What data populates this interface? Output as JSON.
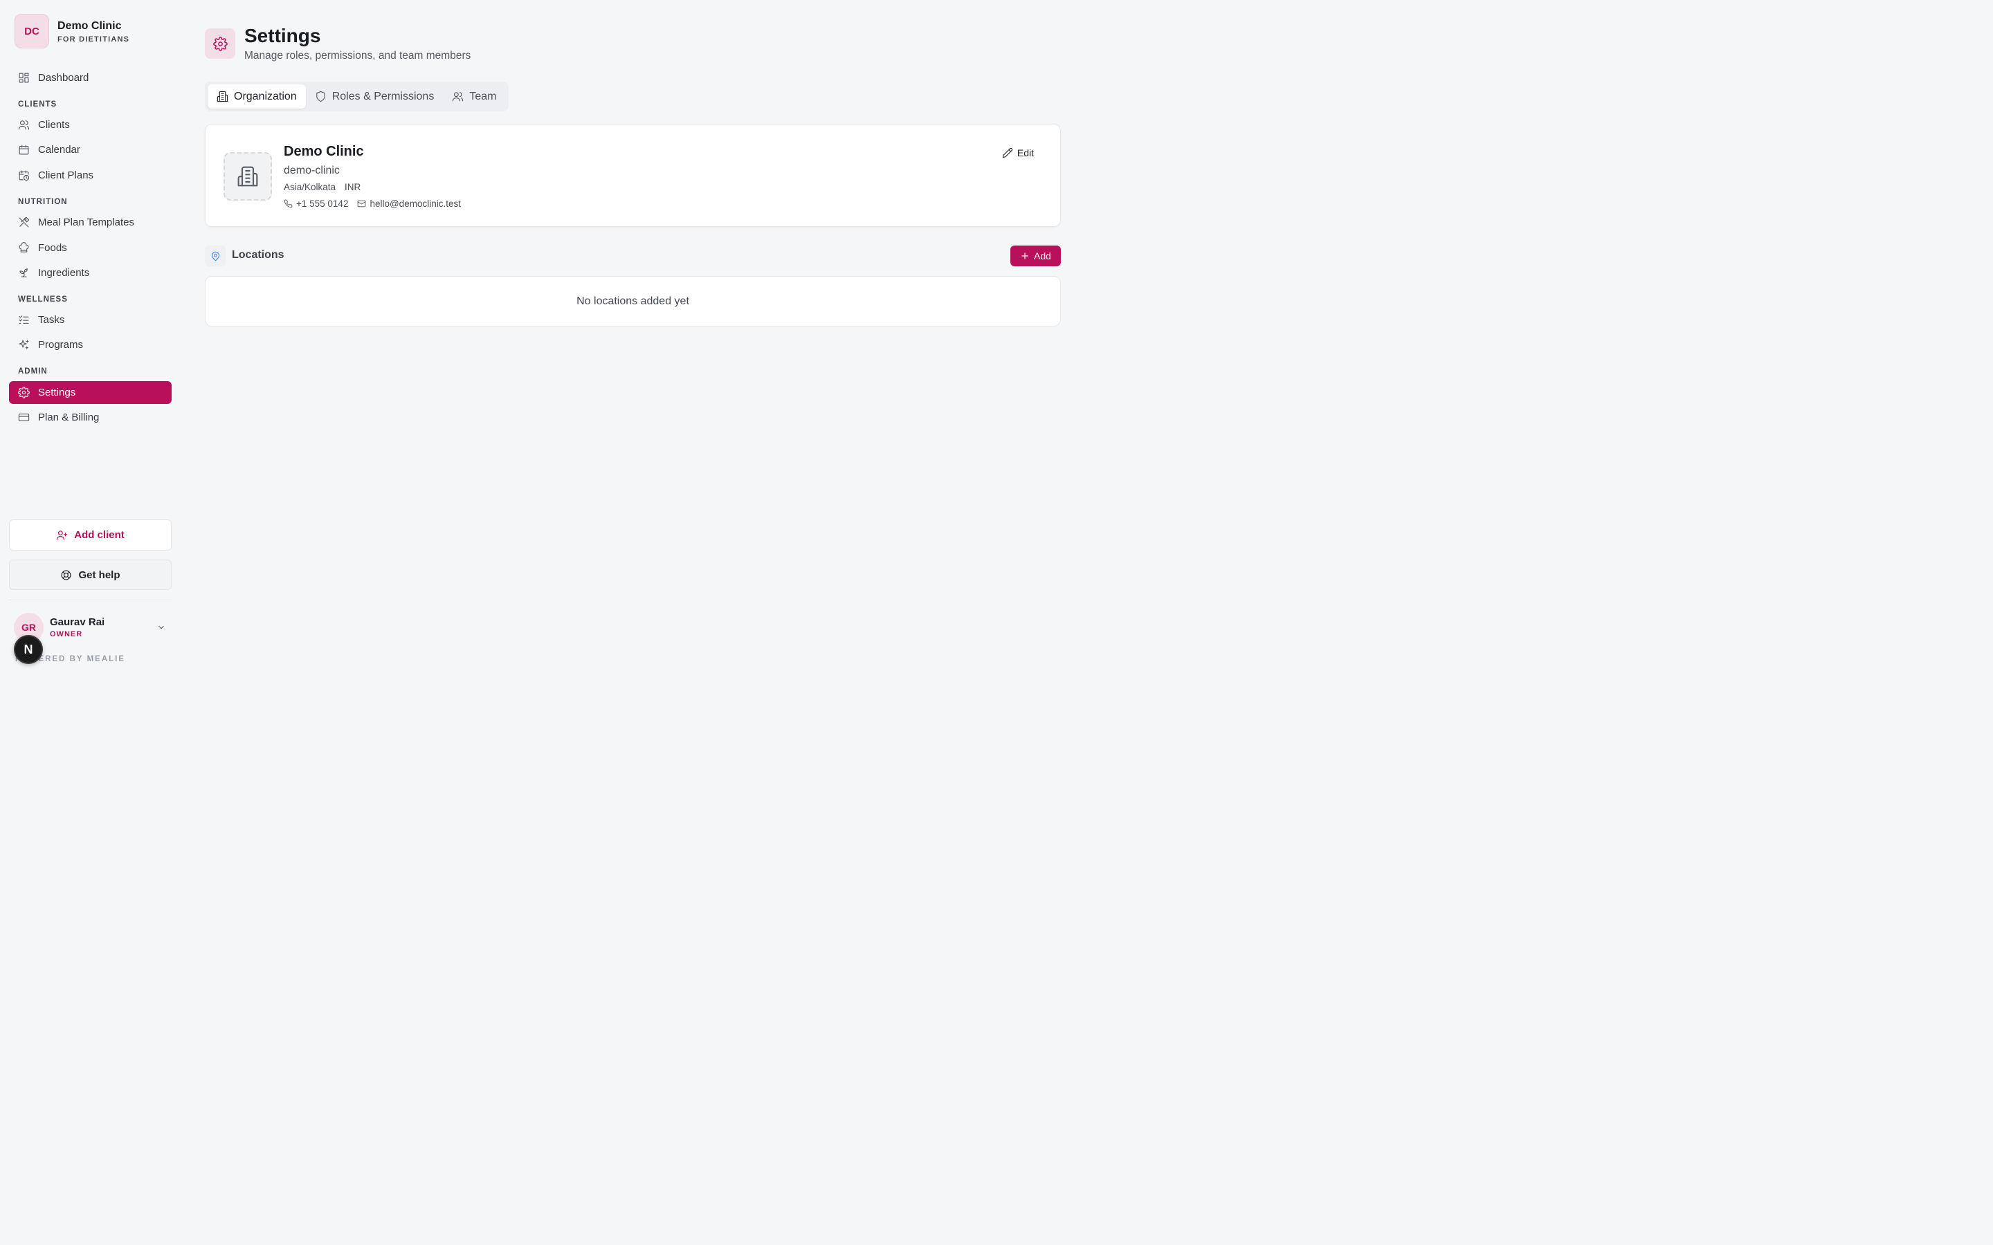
{
  "brand": {
    "initials": "DC",
    "name": "Demo Clinic",
    "subtitle": "FOR DIETITIANS"
  },
  "nav": {
    "dashboard": "Dashboard",
    "sections": {
      "clients": "CLIENTS",
      "nutrition": "NUTRITION",
      "wellness": "WELLNESS",
      "admin": "ADMIN"
    },
    "clients": "Clients",
    "calendar": "Calendar",
    "client_plans": "Client Plans",
    "meal_plan_templates": "Meal Plan Templates",
    "foods": "Foods",
    "ingredients": "Ingredients",
    "tasks": "Tasks",
    "programs": "Programs",
    "settings": "Settings",
    "plan_billing": "Plan & Billing"
  },
  "sidebar_actions": {
    "add_client": "Add client",
    "get_help": "Get help"
  },
  "user": {
    "initials": "GR",
    "name": "Gaurav Rai",
    "role": "OWNER"
  },
  "powered_by": "POWERED BY MEALIE",
  "dev_badge": "N",
  "header": {
    "title": "Settings",
    "subtitle": "Manage roles, permissions, and team members"
  },
  "tabs": {
    "organization": "Organization",
    "roles": "Roles & Permissions",
    "team": "Team"
  },
  "organization": {
    "name": "Demo Clinic",
    "slug": "demo-clinic",
    "timezone": "Asia/Kolkata",
    "currency": "INR",
    "phone": "+1 555 0142",
    "email": "hello@democlinic.test",
    "edit_label": "Edit"
  },
  "locations": {
    "title": "Locations",
    "add_label": "Add",
    "empty_text": "No locations added yet"
  },
  "colors": {
    "accent": "#b8105a",
    "accent_soft": "#f3dde6",
    "background": "#f5f6f8",
    "location_icon": "#3b82f6"
  }
}
